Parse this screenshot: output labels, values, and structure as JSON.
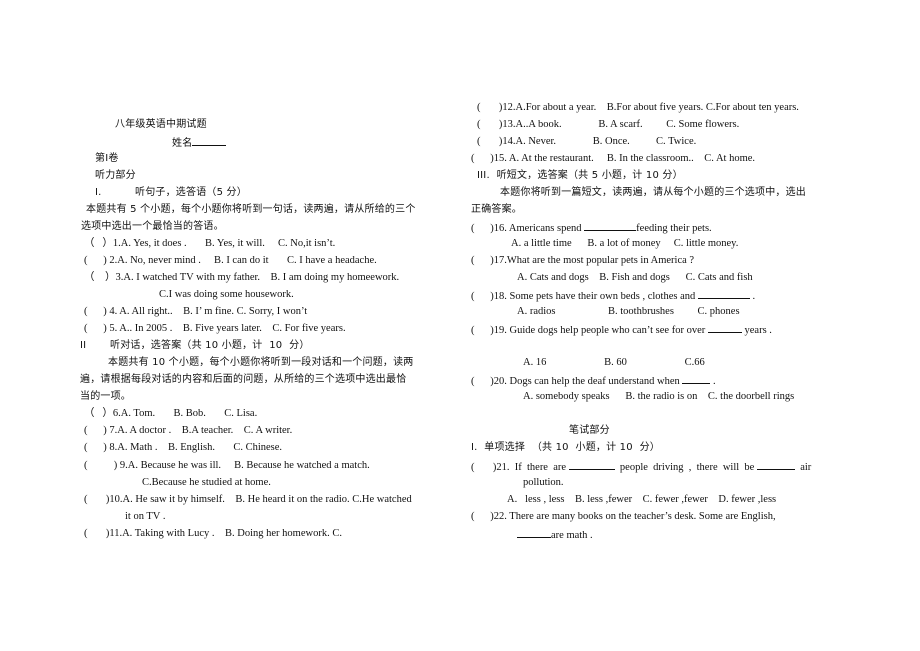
{
  "left": {
    "title": "八年级英语中期试题",
    "name_label": "姓名",
    "volume": "第Ⅰ卷",
    "listening": "听力部分",
    "section1": {
      "num": "I.",
      "title": "听句子，选答语（5 分）"
    },
    "section1_intro_1": "本题共有 5 个小题，每个小题你将听到一句话，读两遍，请从所给的三个",
    "section1_intro_2": "选项中选出一个最恰当的答语。",
    "q1": "（   ）1.A. Yes, it does .       B. Yes, it will.     C. No,it isn’t.",
    "q2": "(      ) 2.A. No, never mind .     B. I can do it       C. I have a headache.",
    "q3a": "（    ）3.A. I watched TV with my father.    B. I am doing my homeework.",
    "q3b": "C.I was doing some housework.",
    "q4": "(      ) 4. A. All right..    B. I’ m fine. C. Sorry, I won’t",
    "q5": "(      ) 5. A.. In 2005 .    B. Five years later.    C. For five years.",
    "section2": {
      "num": "II",
      "title": "听对话，选答案（共 10 小题，计  10  分）"
    },
    "section2_intro_1": "本题共有 10 个小题，每个小题你将听到一段对话和一个问题，读两",
    "section2_intro_2": "遍，请根据每段对话的内容和后面的问题，从所给的三个选项中选出最恰",
    "section2_intro_3": "当的一项。",
    "q6": "（   ）6.A. Tom.       B. Bob.       C. Lisa.",
    "q7": "(      ) 7.A. A doctor .    B.A teacher.    C. A writer.",
    "q8": "(      ) 8.A. Math .    B. English.       C. Chinese.",
    "q9a": "(          ) 9.A. Because he was ill.     B. Because he watched a match.",
    "q9b": "C.Because he studied at home.",
    "q10a": "(       )10.A. He saw it by himself.    B. He heard it on the radio. C.He watched",
    "q10b": "it on TV .",
    "q11": "(       )11.A. Taking with Lucy .    B. Doing her homework. C."
  },
  "right": {
    "q12": "(       )12.A.For about a year.    B.For about five years. C.For about ten years.",
    "q13": "(       )13.A..A book.              B. A scarf.         C. Some flowers.",
    "q14": "(       )14.A. Never.              B. Once.          C. Twice.",
    "q15": "(      )15. A. At the restaurant.     B. In the classroom..    C. At home.",
    "section3": "III.  听短文，选答案（共 5 小题，计 10 分）",
    "section3_intro_1": "本题你将听到一篇短文，读两遍，请从每个小题的三个选项中，选出",
    "section3_intro_2": "正确答案。",
    "q16": "(      )16. Americans spend ",
    "q16_end": "feeding their pets.",
    "q16_opts": "A. a little time      B. a lot of money     C. little money.",
    "q17": "(      )17.What are the most popular pets in America ?",
    "q17_opts": "A. Cats and dogs    B. Fish and dogs      C. Cats and fish",
    "q18": "(      )18. Some pets have their own beds , clothes and ",
    "q18_end": " .",
    "q18_opts": "A. radios                    B. toothbrushes         C. phones",
    "q19": "(      )19. Guide dogs help people who can’t see for over ",
    "q19_end": " years .",
    "q19_opts": "A. 16                      B. 60                      C.66",
    "q20": "(      )20. Dogs can help the deaf understand when ",
    "q20_end": " .",
    "q20_opts": "A. somebody speaks      B. the radio is on    C. the doorbell rings",
    "written": "笔试部分",
    "section_w1": "I.  单项选择  （共 10  小题，计 10  分）",
    "q21a": "(       )21.  If  there  are ",
    "q21_mid": "  people  driving  ,  there  will  be ",
    "q21_end": "  air",
    "q21b": "pollution.",
    "q21_opts": "A.   less , less    B. less ,fewer    C. fewer ,fewer    D. fewer ,less",
    "q22a": "(      )22. There are many books on the teacher’s desk. Some are English,",
    "q22b": "are math ."
  }
}
